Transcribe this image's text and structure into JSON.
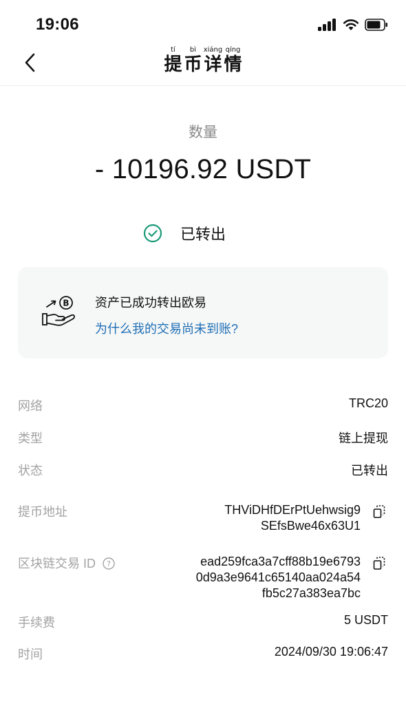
{
  "status_bar": {
    "time": "19:06"
  },
  "nav": {
    "title_chars": [
      {
        "pinyin": "tí",
        "hanzi": "提"
      },
      {
        "pinyin": "bì",
        "hanzi": "币"
      },
      {
        "pinyin": "xiáng",
        "hanzi": "详"
      },
      {
        "pinyin": "qíng",
        "hanzi": "情"
      }
    ]
  },
  "amount": {
    "label": "数量",
    "value": "- 10196.92 USDT"
  },
  "status": {
    "text": "已转出",
    "color": "#1a9a78"
  },
  "card": {
    "title": "资产已成功转出欧易",
    "link": "为什么我的交易尚未到账?"
  },
  "details": {
    "network": {
      "label": "网络",
      "value": "TRC20"
    },
    "type": {
      "label": "类型",
      "value": "链上提现"
    },
    "state": {
      "label": "状态",
      "value": "已转出"
    },
    "address": {
      "label": "提币地址",
      "line1": "THViDHfDErPtUehwsig9",
      "line2": "SEfsBwe46x63U1"
    },
    "txid": {
      "label": "区块链交易 ID",
      "line1": "ead259fca3a7cff88b19e6793",
      "line2": "0d9a3e9641c65140aa024a54",
      "line3": "fb5c27a383ea7bc"
    },
    "fee": {
      "label": "手续费",
      "value": "5 USDT"
    },
    "time": {
      "label": "时间",
      "value": "2024/09/30 19:06:47"
    }
  },
  "icons": {
    "back": "chevron-left-icon",
    "check": "check-circle-icon",
    "hand": "hand-coin-icon",
    "copy": "copy-icon",
    "help": "help-circle-icon"
  },
  "colors": {
    "accent": "#1a9a78",
    "link": "#1f6fb5"
  }
}
